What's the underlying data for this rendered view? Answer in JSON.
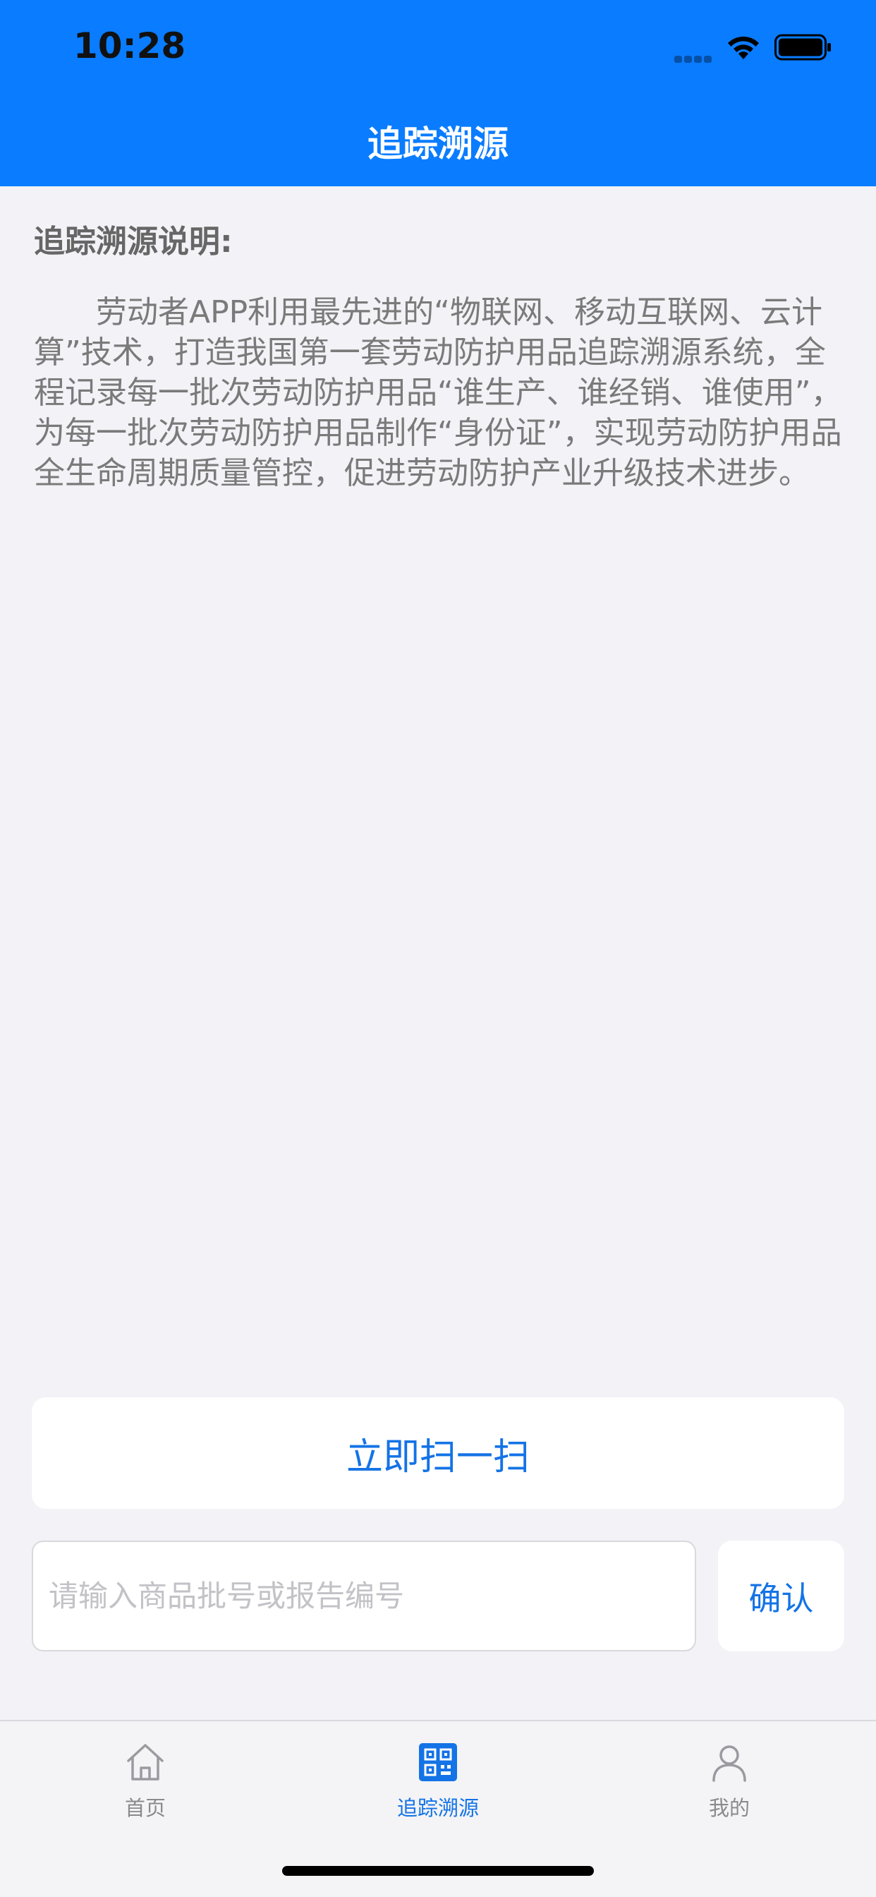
{
  "status_bar": {
    "time": "10:28"
  },
  "nav": {
    "title": "追踪溯源"
  },
  "description": {
    "heading": "追踪溯源说明:",
    "body": "劳动者APP利用最先进的“物联网、移动互联网、云计算”技术，打造我国第一套劳动防护用品追踪溯源系统，全程记录每一批次劳动防护用品“谁生产、谁经销、谁使用”，为每一批次劳动防护用品制作“身份证”，实现劳动防护用品全生命周期质量管控，促进劳动防护产业升级技术进步。"
  },
  "actions": {
    "scan_label": "立即扫一扫",
    "search_placeholder": "请输入商品批号或报告编号",
    "search_value": "",
    "confirm_label": "确认"
  },
  "tab_bar": {
    "items": [
      {
        "label": "首页",
        "icon": "home-icon",
        "active": false
      },
      {
        "label": "追踪溯源",
        "icon": "qr-code-icon",
        "active": true
      },
      {
        "label": "我的",
        "icon": "person-icon",
        "active": false
      }
    ]
  },
  "colors": {
    "nav_background": "#0a7cff",
    "accent": "#1473e6",
    "page_background": "#f2f2f7"
  }
}
